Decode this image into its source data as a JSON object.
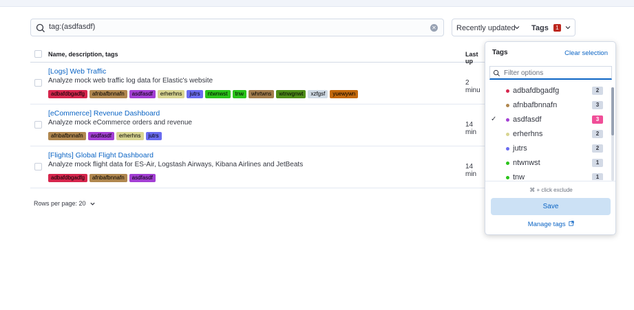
{
  "search": {
    "value": "tag:(asdfasdf)"
  },
  "sort": {
    "label": "Recently updated"
  },
  "tags_button": {
    "label": "Tags",
    "count": "1"
  },
  "table": {
    "col_name": "Name, description, tags",
    "col_updated": "Last up",
    "rows": [
      {
        "title": "[Logs] Web Traffic",
        "description": "Analyze mock web traffic log data for Elastic's website",
        "updated": "2 minu",
        "tags": [
          {
            "name": "adbafdbgadfg",
            "bg": "#d6264d",
            "fg": "#000"
          },
          {
            "name": "afnbafbnnafn",
            "bg": "#b0874f",
            "fg": "#000"
          },
          {
            "name": "asdfasdf",
            "bg": "#a33fd4",
            "fg": "#000"
          },
          {
            "name": "erherhns",
            "bg": "#d8d592",
            "fg": "#000"
          },
          {
            "name": "jutrs",
            "bg": "#6a6cf0",
            "fg": "#000"
          },
          {
            "name": "ntwnwst",
            "bg": "#2bc31b",
            "fg": "#000"
          },
          {
            "name": "tnw",
            "bg": "#2bc31b",
            "fg": "#000"
          },
          {
            "name": "whrtwns",
            "bg": "#a37d4c",
            "fg": "#000"
          },
          {
            "name": "wtnwgnwt",
            "bg": "#4f8e19",
            "fg": "#000"
          },
          {
            "name": "xzfgsf",
            "bg": "#d0dbe5",
            "fg": "#000"
          },
          {
            "name": "yuewywn",
            "bg": "#c3690d",
            "fg": "#000"
          }
        ]
      },
      {
        "title": "[eCommerce] Revenue Dashboard",
        "description": "Analyze mock eCommerce orders and revenue",
        "updated": "14 min",
        "tags": [
          {
            "name": "afnbafbnnafn",
            "bg": "#b0874f",
            "fg": "#000"
          },
          {
            "name": "asdfasdf",
            "bg": "#a33fd4",
            "fg": "#000"
          },
          {
            "name": "erherhns",
            "bg": "#d8d592",
            "fg": "#000"
          },
          {
            "name": "jutrs",
            "bg": "#6a6cf0",
            "fg": "#000"
          }
        ]
      },
      {
        "title": "[Flights] Global Flight Dashboard",
        "description": "Analyze mock flight data for ES-Air, Logstash Airways, Kibana Airlines and JetBeats",
        "updated": "14 min",
        "tags": [
          {
            "name": "adbafdbgadfg",
            "bg": "#d6264d",
            "fg": "#000"
          },
          {
            "name": "afnbafbnnafn",
            "bg": "#b0874f",
            "fg": "#000"
          },
          {
            "name": "asdfasdf",
            "bg": "#a33fd4",
            "fg": "#000"
          }
        ]
      }
    ]
  },
  "pagination": {
    "rows_per_page": "Rows per page: 20"
  },
  "tags_popover": {
    "title": "Tags",
    "clear_label": "Clear selection",
    "filter_placeholder": "Filter options",
    "options": [
      {
        "name": "adbafdbgadfg",
        "count": "2",
        "color": "#d6264d",
        "selected": false
      },
      {
        "name": "afnbafbnnafn",
        "count": "3",
        "color": "#b0874f",
        "selected": false
      },
      {
        "name": "asdfasdf",
        "count": "3",
        "color": "#a33fd4",
        "selected": true
      },
      {
        "name": "erherhns",
        "count": "2",
        "color": "#d8d592",
        "selected": false
      },
      {
        "name": "jutrs",
        "count": "2",
        "color": "#6a6cf0",
        "selected": false
      },
      {
        "name": "ntwnwst",
        "count": "1",
        "color": "#2bc31b",
        "selected": false
      },
      {
        "name": "tnw",
        "count": "1",
        "color": "#2bc31b",
        "selected": false
      }
    ],
    "hint": "⌘ + click exclude",
    "save_label": "Save",
    "manage_label": "Manage tags"
  }
}
